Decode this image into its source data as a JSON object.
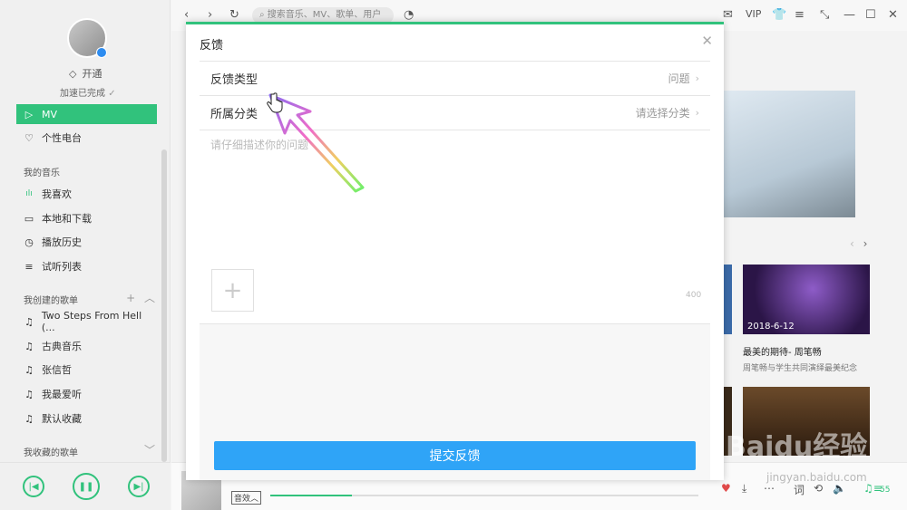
{
  "sidebar": {
    "open_vip": "开通",
    "accel_status": "加速已完成",
    "nav": [
      {
        "label": "MV",
        "icon": "mv-icon",
        "active": true
      },
      {
        "label": "个性电台",
        "icon": "heart-radio-icon",
        "active": false
      }
    ],
    "my_music_title": "我的音乐",
    "my_music": [
      {
        "label": "我喜欢",
        "icon": "equalizer-icon"
      },
      {
        "label": "本地和下载",
        "icon": "monitor-icon"
      },
      {
        "label": "播放历史",
        "icon": "clock-icon"
      },
      {
        "label": "试听列表",
        "icon": "list-icon"
      }
    ],
    "created_title": "我创建的歌单",
    "created": [
      {
        "label": "Two Steps From Hell (..."
      },
      {
        "label": "古典音乐"
      },
      {
        "label": "张信哲"
      },
      {
        "label": "我最爱听"
      },
      {
        "label": "默认收藏"
      }
    ],
    "collected_title": "我收藏的歌单"
  },
  "topbar": {
    "search_placeholder": "搜索音乐、MV、歌单、用户",
    "vip_label": "VIP"
  },
  "modal": {
    "title": "反馈",
    "rows": [
      {
        "label": "反馈类型",
        "value": "问题"
      },
      {
        "label": "所属分类",
        "value": "请选择分类"
      }
    ],
    "text_placeholder": "请仔细描述你的问题",
    "char_count": "400",
    "submit_label": "提交反馈"
  },
  "content": {
    "card_date": "2018-6-12",
    "card_title": "最美的期待- 周笔畅",
    "card_sub": "周笔畅与学生共同演绎最美纪念"
  },
  "player": {
    "fx_label": "音效",
    "progress_fraction": 0.19,
    "lyrics_label": "词",
    "count": "55"
  },
  "watermark": {
    "text": "Baidu经验",
    "url": "jingyan.baidu.com"
  },
  "colors": {
    "accent": "#31c27c",
    "submit": "#2fa4f7"
  }
}
